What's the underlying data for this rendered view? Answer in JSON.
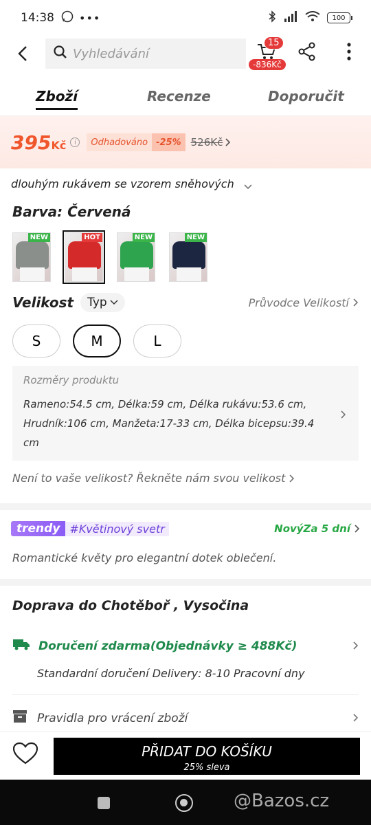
{
  "status": {
    "time": "14:38",
    "battery": "100"
  },
  "search": {
    "placeholder": "Vyhledávání"
  },
  "cart": {
    "count": "15",
    "saving": "-836Kč"
  },
  "tabs": [
    {
      "label": "Zboží"
    },
    {
      "label": "Recenze"
    },
    {
      "label": "Doporučit"
    }
  ],
  "price": {
    "value": "395",
    "currency": "Kč",
    "estimate_label": "Odhadováno",
    "discount": "-25%",
    "old_price": "526Kč"
  },
  "description": "dlouhým rukávem se vzorem sněhových",
  "color": {
    "label": "Barva: Červená"
  },
  "swatches": [
    {
      "badge": "NEW",
      "color": "#8a8f8c"
    },
    {
      "badge": "HOT",
      "color": "#d42a2a"
    },
    {
      "badge": "NEW",
      "color": "#2ea44f"
    },
    {
      "badge": "NEW",
      "color": "#1d2640"
    }
  ],
  "size": {
    "label": "Velikost",
    "type_label": "Typ",
    "guide_label": "Průvodce Velikostí",
    "options": [
      "S",
      "M",
      "L"
    ],
    "selected": "M"
  },
  "dimensions": {
    "title": "Rozměry produktu",
    "text": "Rameno:54.5 cm, Délka:59 cm, Délka rukávu:53.6 cm, Hrudník:106 cm, Manžeta:17-33 cm, Délka bicepsu:39.4 cm"
  },
  "not_size": "Není to vaše velikost? Řekněte nám svou velikost",
  "trendy": {
    "logo": "trendy",
    "tag": "#Květinový svetr",
    "new_days": "NovýZa 5 dní",
    "description": "Romantické květy pro elegantní dotek oblečení."
  },
  "shipping": {
    "title": "Doprava do Chotěboř , Vysočina",
    "free": "Doručení zdarma(Objednávky ≥ 488Kč)",
    "detail": "Standardní doručení Delivery: 8-10 Pracovní dny",
    "returns": "Pravidla pro vrácení zboží"
  },
  "bottom": {
    "add_label": "PŘIDAT DO KOŠÍKU",
    "add_sub": "25% sleva"
  },
  "watermark": "@Bazos.cz"
}
